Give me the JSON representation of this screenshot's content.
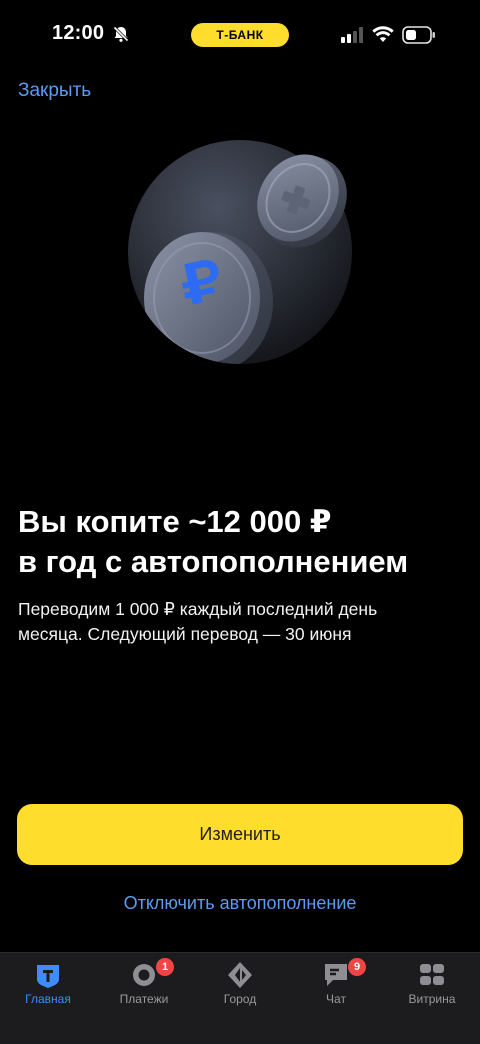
{
  "status_bar": {
    "time": "12:00",
    "bank_label": "Т-БАНК"
  },
  "close_label": "Закрыть",
  "headline_line1": "Вы копите ~12 000 ₽",
  "headline_line2": "в год с автопополнением",
  "description_line1": "Переводим 1 000 ₽ каждый последний день",
  "description_line2": "месяца. Следующий перевод — 30 июня",
  "primary_button_label": "Изменить",
  "secondary_link_label": "Отключить автопополнение",
  "tabs": [
    {
      "label": "Главная",
      "icon": "home-icon",
      "active": true
    },
    {
      "label": "Платежи",
      "icon": "payments-icon",
      "badge": "1"
    },
    {
      "label": "Город",
      "icon": "city-icon"
    },
    {
      "label": "Чат",
      "icon": "chat-icon",
      "badge": "9"
    },
    {
      "label": "Витрина",
      "icon": "showcase-icon"
    }
  ],
  "colors": {
    "accent_yellow": "#ffdd2d",
    "link_blue": "#5b9cf2",
    "active_tab": "#3f8cff",
    "badge_red": "#f04545"
  }
}
